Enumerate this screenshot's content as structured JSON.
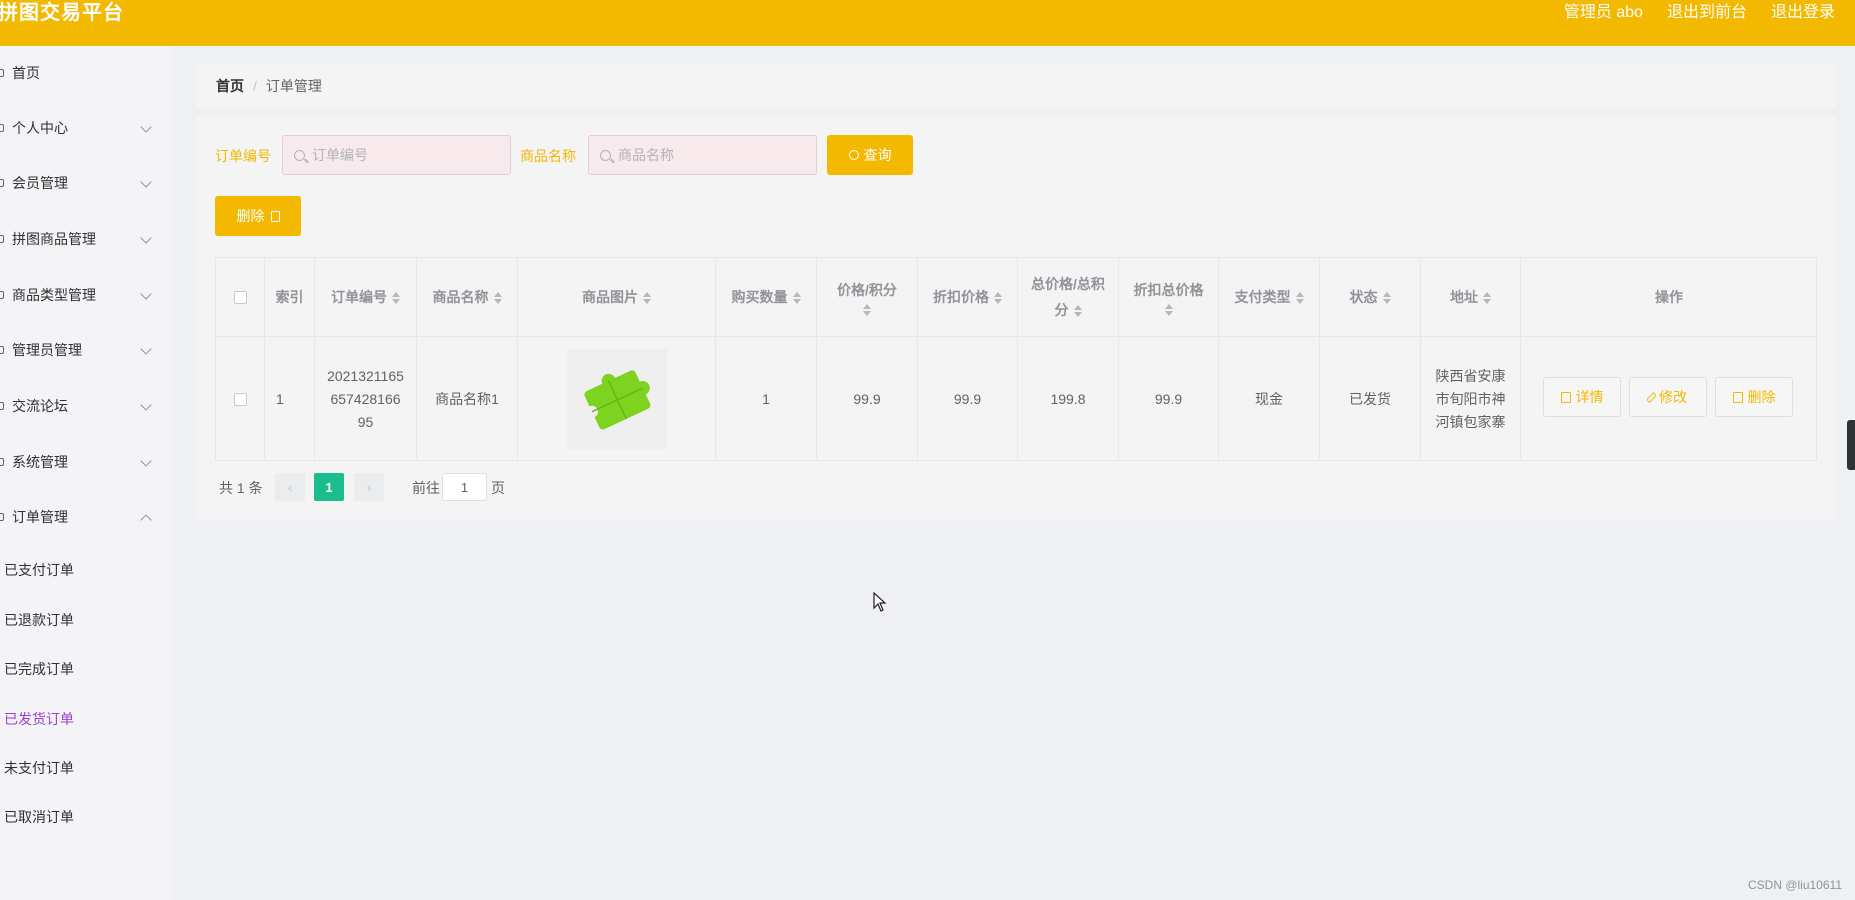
{
  "header": {
    "title": "拼图交易平台",
    "admin": "管理员 abo",
    "frontend": "退出到前台",
    "logout": "退出登录",
    "color": "#f3b800"
  },
  "sidebar": {
    "items": [
      {
        "label": "首页",
        "icon": "home-icon",
        "expandable": false
      },
      {
        "label": "个人中心",
        "icon": "user-icon",
        "expandable": true
      },
      {
        "label": "会员管理",
        "icon": "member-icon",
        "expandable": true
      },
      {
        "label": "拼图商品管理",
        "icon": "puzzle-icon",
        "expandable": true
      },
      {
        "label": "商品类型管理",
        "icon": "category-icon",
        "expandable": true
      },
      {
        "label": "管理员管理",
        "icon": "admin-icon",
        "expandable": true
      },
      {
        "label": "交流论坛",
        "icon": "forum-icon",
        "expandable": true
      },
      {
        "label": "系统管理",
        "icon": "system-icon",
        "expandable": true
      },
      {
        "label": "订单管理",
        "icon": "order-icon",
        "expandable": true,
        "open": true
      }
    ],
    "sub_items": [
      {
        "label": "已支付订单",
        "active": false
      },
      {
        "label": "已退款订单",
        "active": false
      },
      {
        "label": "已完成订单",
        "active": false
      },
      {
        "label": "已发货订单",
        "active": true
      },
      {
        "label": "未支付订单",
        "active": false
      },
      {
        "label": "已取消订单",
        "active": false
      }
    ],
    "active_color": "#9b3fd1"
  },
  "breadcrumb": {
    "home": "首页",
    "sep": "/",
    "current": "订单管理"
  },
  "search": {
    "order_label": "订单编号",
    "order_placeholder": "订单编号",
    "product_label": "商品名称",
    "product_placeholder": "商品名称",
    "query_button": "查询"
  },
  "toolbar": {
    "delete_label": "删除"
  },
  "table": {
    "headers": [
      "索引",
      "订单编号",
      "商品名称",
      "商品图片",
      "购买数量",
      "价格/积分",
      "折扣价格",
      "总价格/总积分",
      "折扣总价格",
      "支付类型",
      "状态",
      "地址",
      "操作"
    ],
    "rows": [
      {
        "index": "1",
        "order_no": "202132116565742816695",
        "product_name": "商品名称1",
        "image": "green-puzzle-image",
        "quantity": "1",
        "price": "99.9",
        "discount_price": "99.9",
        "total_price": "199.8",
        "discount_total": "99.9",
        "pay_type": "现金",
        "status": "已发货",
        "address": "陕西省安康市旬阳市神河镇包家寨"
      }
    ],
    "actions": {
      "detail": "详情",
      "edit": "修改",
      "delete": "删除"
    }
  },
  "pagination": {
    "total": "共 1 条",
    "prev": "‹",
    "current_page": "1",
    "next": "›",
    "goto_label": "前往",
    "goto_value": "1",
    "page_suffix": "页",
    "current_color": "#1bbd8d"
  },
  "watermark": "CSDN @liu10611"
}
